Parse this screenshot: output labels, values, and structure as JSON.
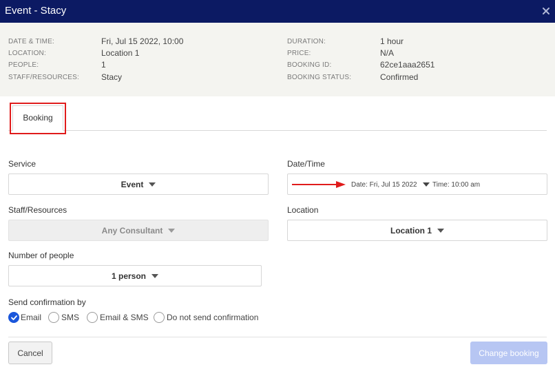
{
  "window": {
    "title": "Event - Stacy"
  },
  "summary": {
    "left": [
      {
        "label": "DATE & TIME:",
        "value": "Fri, Jul 15 2022, 10:00"
      },
      {
        "label": "LOCATION:",
        "value": "Location 1"
      },
      {
        "label": "PEOPLE:",
        "value": "1"
      },
      {
        "label": "STAFF/RESOURCES:",
        "value": "Stacy"
      }
    ],
    "right": [
      {
        "label": "DURATION:",
        "value": "1 hour"
      },
      {
        "label": "PRICE:",
        "value": "N/A"
      },
      {
        "label": "BOOKING ID:",
        "value": "62ce1aaa2651"
      },
      {
        "label": "BOOKING STATUS:",
        "value": "Confirmed"
      }
    ]
  },
  "tabs": [
    {
      "label": "Booking"
    }
  ],
  "form": {
    "service": {
      "label": "Service",
      "value": "Event"
    },
    "datetime": {
      "label": "Date/Time",
      "date": "Date: Fri, Jul 15 2022",
      "time": "Time: 10:00 am"
    },
    "staff": {
      "label": "Staff/Resources",
      "value": "Any Consultant"
    },
    "location": {
      "label": "Location",
      "value": "Location 1"
    },
    "people": {
      "label": "Number of people",
      "value": "1 person"
    },
    "confirmation": {
      "label": "Send confirmation by",
      "options": [
        "Email",
        "SMS",
        "Email & SMS",
        "Do not send confirmation"
      ],
      "selected": "Email"
    }
  },
  "footer": {
    "cancel_label": "Cancel",
    "change_label": "Change booking"
  },
  "colors": {
    "titlebar": "#0c1a63",
    "accent": "#1a56db",
    "highlight": "#e01b1b",
    "button_disabled": "#b7c6f3"
  }
}
